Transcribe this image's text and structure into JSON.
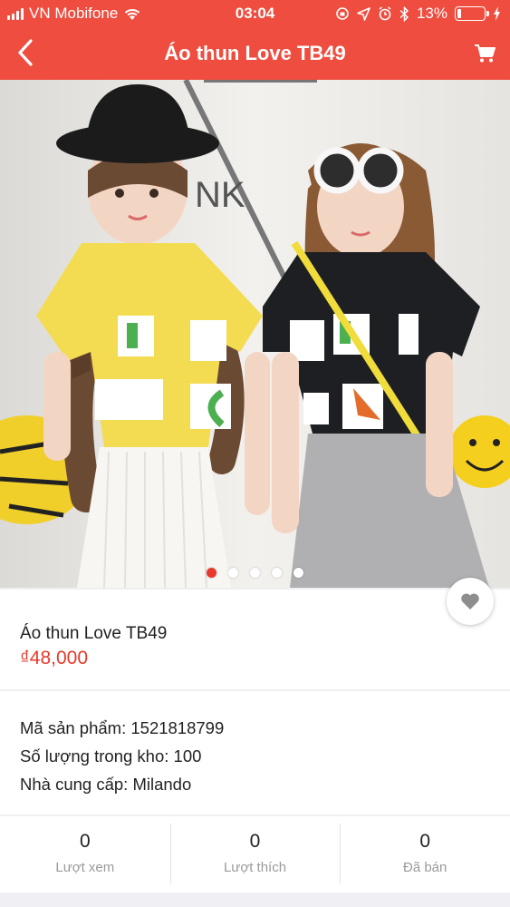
{
  "status_bar": {
    "carrier": "VN Mobifone",
    "time": "03:04",
    "battery_percent": "13%",
    "battery_level": 0.13
  },
  "nav": {
    "title": "Áo thun Love TB49",
    "back_icon": "chevron-left-icon",
    "cart_icon": "cart-icon"
  },
  "gallery": {
    "slide_count": 5,
    "active_index": 0
  },
  "product": {
    "name": "Áo thun Love TB49",
    "price": "₫48,000"
  },
  "details": {
    "sku": "Mã sản phẩm: 1521818799",
    "stock": "Số lượng trong kho: 100",
    "supplier": "Nhà cung cấp: Milando"
  },
  "stats": [
    {
      "value": "0",
      "label": "Lượt xem"
    },
    {
      "value": "0",
      "label": "Lượt thích"
    },
    {
      "value": "0",
      "label": "Đã bán"
    }
  ],
  "colors": {
    "brand": "#ee4d3f",
    "price": "#e8392c"
  }
}
